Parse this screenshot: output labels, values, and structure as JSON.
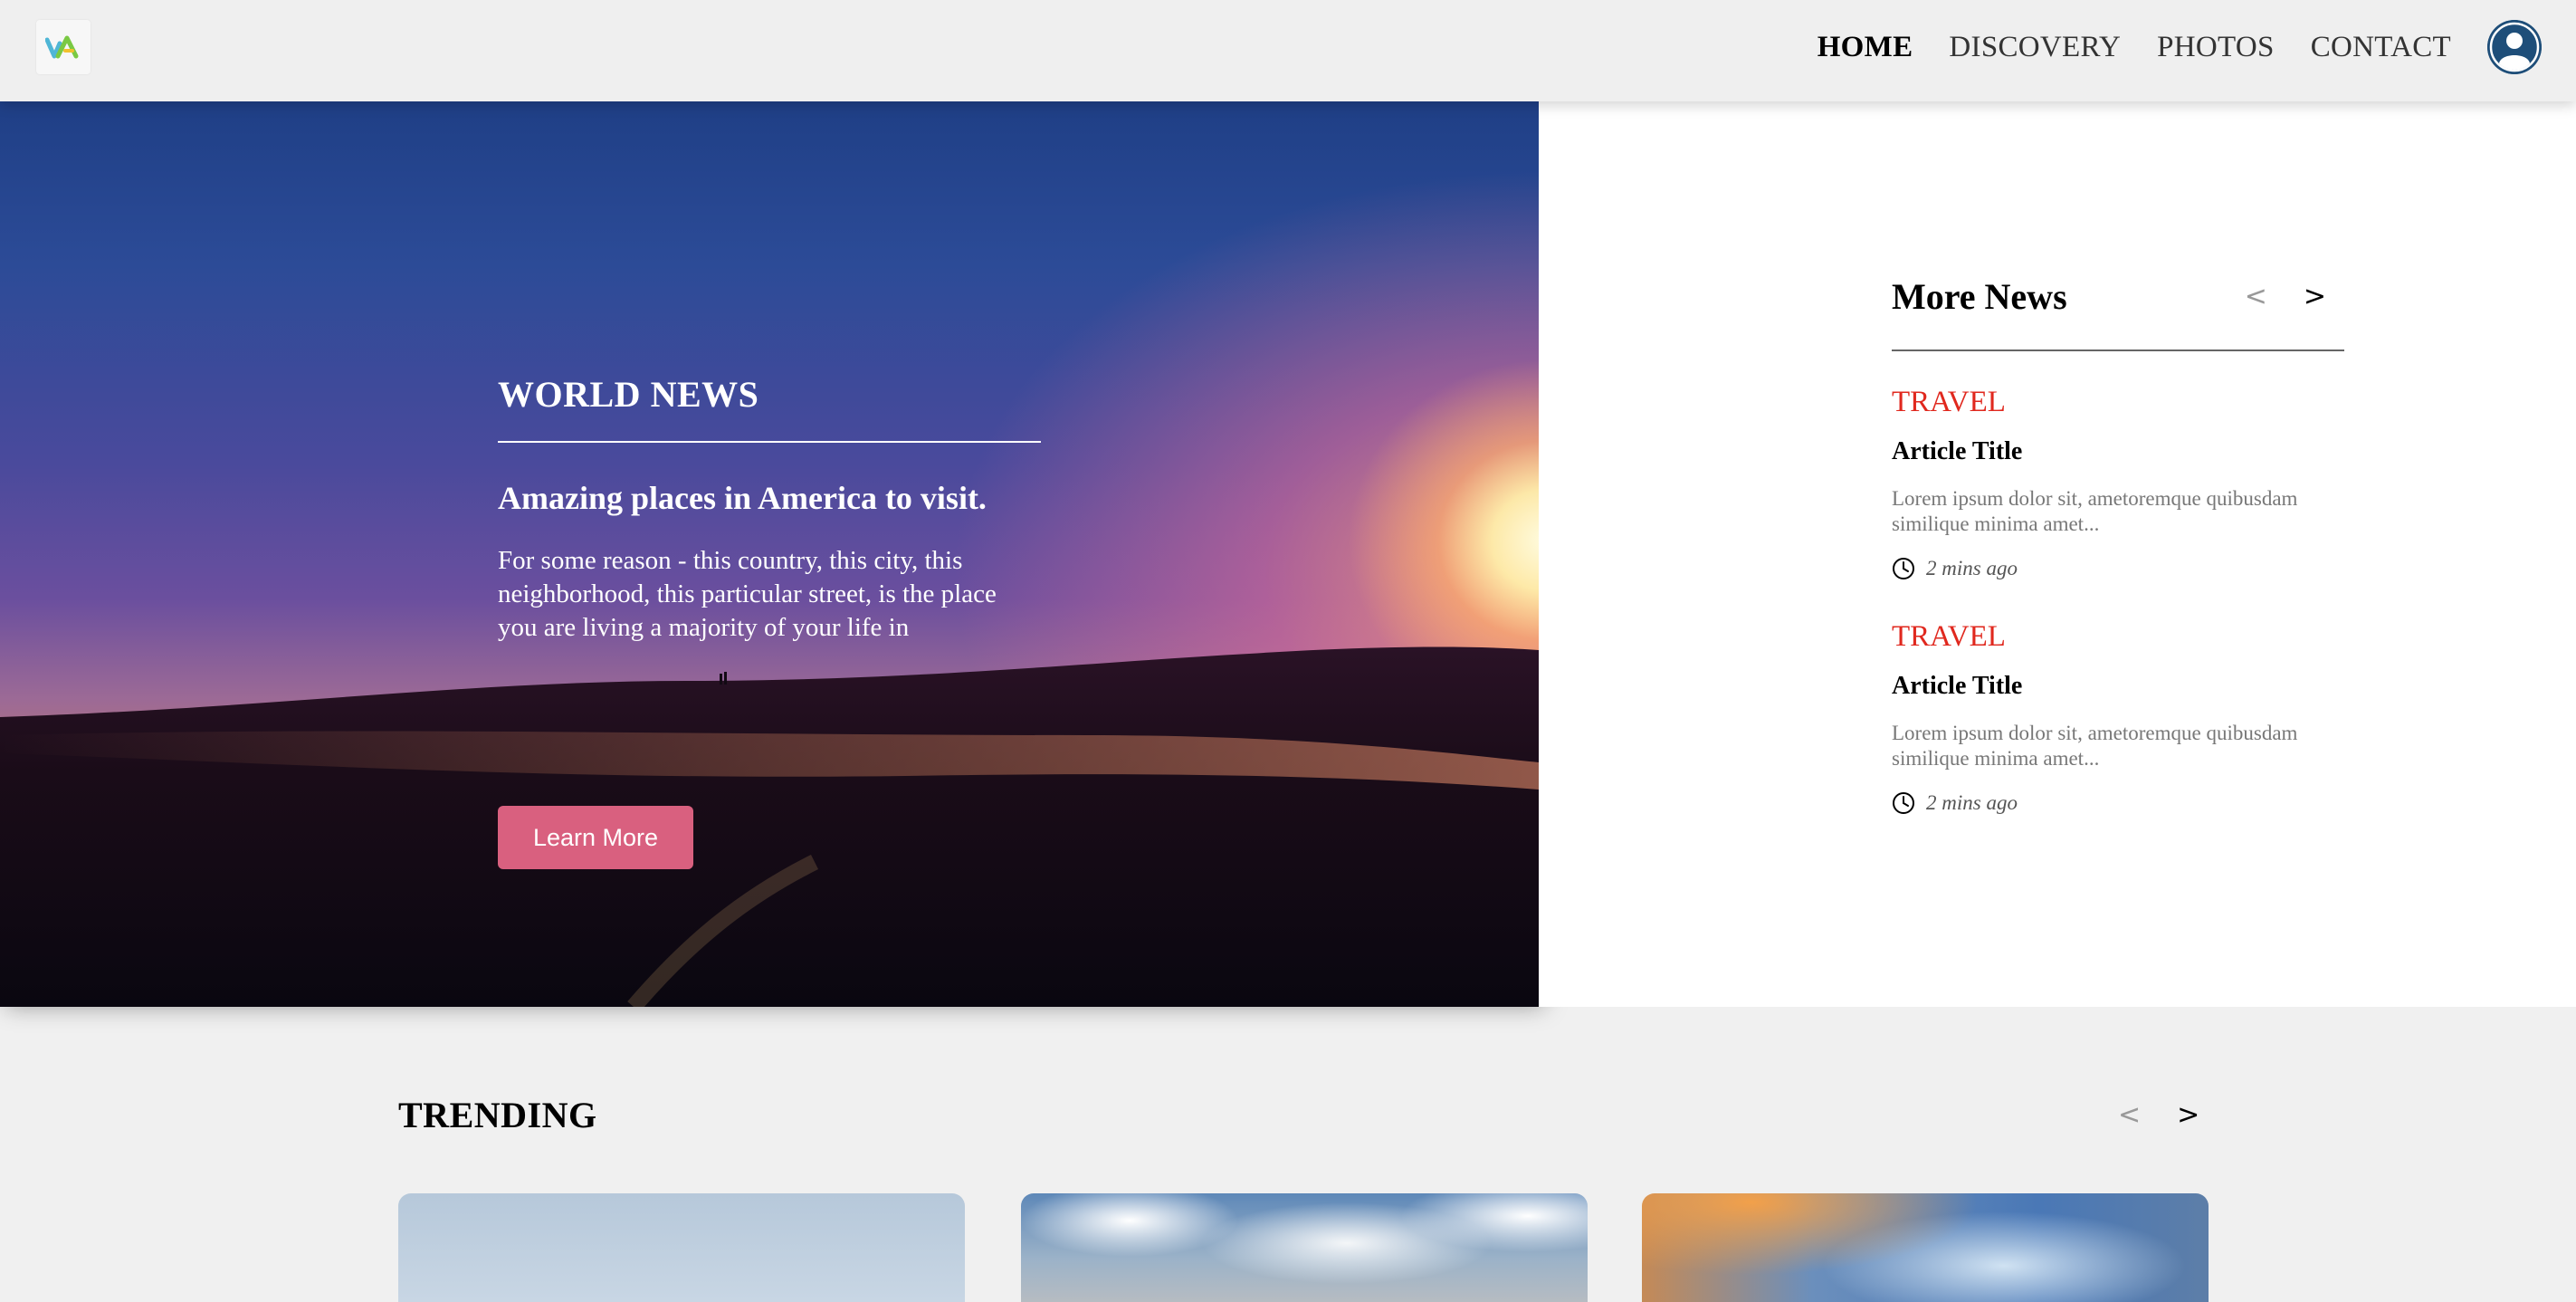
{
  "nav": {
    "logo": "logo",
    "links": [
      {
        "label": "HOME",
        "active": true
      },
      {
        "label": "DISCOVERY",
        "active": false
      },
      {
        "label": "PHOTOS",
        "active": false
      },
      {
        "label": "CONTACT",
        "active": false
      }
    ],
    "avatar_icon": "user-avatar-icon"
  },
  "hero": {
    "kicker": "WORLD NEWS",
    "title": "Amazing places in America to visit.",
    "text": "For some reason - this country, this city, this neighborhood, this particular street, is the place you are living a majority of your life in",
    "button": "Learn More",
    "button_color": "#d9607f"
  },
  "more_news": {
    "title": "More News",
    "prev": "<",
    "next": ">",
    "articles": [
      {
        "category": "TRAVEL",
        "title": "Article Title",
        "text": "Lorem ipsum dolor sit, ametoremque quibusdam similique minima amet...",
        "time": "2 mins ago"
      },
      {
        "category": "TRAVEL",
        "title": "Article Title",
        "text": "Lorem ipsum dolor sit, ametoremque quibusdam similique minima amet...",
        "time": "2 mins ago"
      }
    ],
    "category_color": "#e0281e"
  },
  "trending": {
    "title": "TRENDING",
    "prev": "<",
    "next": ">"
  }
}
